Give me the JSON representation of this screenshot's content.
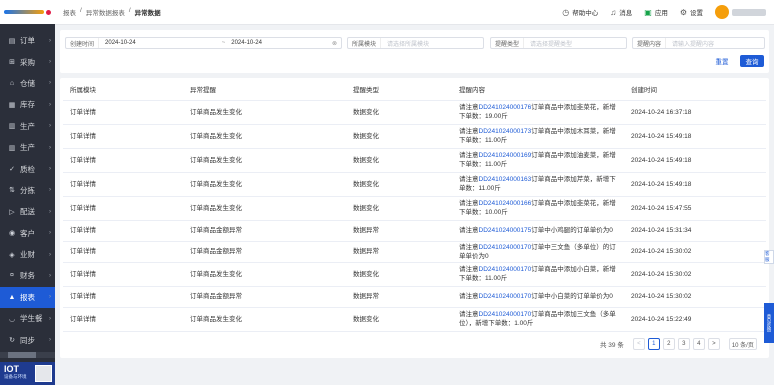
{
  "sidebar": {
    "items": [
      {
        "label": "订单",
        "icon": "document-icon"
      },
      {
        "label": "采购",
        "icon": "cart-icon"
      },
      {
        "label": "仓储",
        "icon": "warehouse-icon"
      },
      {
        "label": "库存",
        "icon": "box-icon"
      },
      {
        "label": "生产",
        "icon": "factory-icon"
      },
      {
        "label": "生产",
        "icon": "factory-icon"
      },
      {
        "label": "质检",
        "icon": "check-icon"
      },
      {
        "label": "分拣",
        "icon": "sort-icon"
      },
      {
        "label": "配送",
        "icon": "truck-icon"
      },
      {
        "label": "客户",
        "icon": "user-icon"
      },
      {
        "label": "业财",
        "icon": "finance-icon"
      },
      {
        "label": "财务",
        "icon": "money-icon"
      },
      {
        "label": "报表",
        "icon": "chart-icon"
      },
      {
        "label": "学生餐",
        "icon": "bowl-icon"
      },
      {
        "label": "同步",
        "icon": "sync-icon"
      }
    ],
    "active_index": 12,
    "iot": {
      "title": "IOT",
      "subtitle": "设备与环境"
    }
  },
  "header": {
    "breadcrumb": [
      "报表",
      "异常数据报表",
      "异常数据"
    ],
    "help": "帮助中心",
    "messages": "消息",
    "apps": "应用",
    "settings": "设置"
  },
  "filter": {
    "created_label": "创建时间",
    "date_start": "2024-10-24",
    "date_sep": "~",
    "date_end": "2024-10-24",
    "module_label": "所属模块",
    "module_placeholder": "请选择所属模块",
    "type_label": "提醒类型",
    "type_placeholder": "请选择提醒类型",
    "content_label": "提醒内容",
    "content_placeholder": "请输入提醒内容",
    "reset": "重置",
    "search": "查询"
  },
  "table": {
    "headers": [
      "所属模块",
      "异常提醒",
      "提醒类型",
      "提醒内容",
      "创建时间"
    ],
    "rows": [
      {
        "module": "订单详情",
        "alert": "订单商品发生变化",
        "type": "数据变化",
        "pre": "请注意",
        "code": "DD241024000176",
        "post": "订单商品中添加韭菜花，新增下单数：19.00斤",
        "time": "2024-10-24 16:37:18"
      },
      {
        "module": "订单详情",
        "alert": "订单商品发生变化",
        "type": "数据变化",
        "pre": "请注意",
        "code": "DD241024000173",
        "post": "订单商品中添加木耳菜，新增下单数：11.00斤",
        "time": "2024-10-24 15:49:18"
      },
      {
        "module": "订单详情",
        "alert": "订单商品发生变化",
        "type": "数据变化",
        "pre": "请注意",
        "code": "DD241024000169",
        "post": "订单商品中添加油麦菜，新增下单数：11.00斤",
        "time": "2024-10-24 15:49:18"
      },
      {
        "module": "订单详情",
        "alert": "订单商品发生变化",
        "type": "数据变化",
        "pre": "请注意",
        "code": "DD241024000163",
        "post": "订单商品中添加芹菜，新增下单数：11.00斤",
        "time": "2024-10-24 15:49:18"
      },
      {
        "module": "订单详情",
        "alert": "订单商品发生变化",
        "type": "数据变化",
        "pre": "请注意",
        "code": "DD241024000166",
        "post": "订单商品中添加韭菜花，新增下单数：10.00斤",
        "time": "2024-10-24 15:47:55"
      },
      {
        "module": "订单详情",
        "alert": "订单商品金额异常",
        "type": "数据异常",
        "pre": "请注意",
        "code": "DD241024000175",
        "post": "订单中小鸡腿的订单单价为0",
        "time": "2024-10-24 15:31:34"
      },
      {
        "module": "订单详情",
        "alert": "订单商品金额异常",
        "type": "数据异常",
        "pre": "请注意",
        "code": "DD241024000170",
        "post": "订单中三文鱼（多单位）的订单单价为0",
        "time": "2024-10-24 15:30:02"
      },
      {
        "module": "订单详情",
        "alert": "订单商品发生变化",
        "type": "数据变化",
        "pre": "请注意",
        "code": "DD241024000170",
        "post": "订单商品中添加小白菜，新增下单数：11.00斤",
        "time": "2024-10-24 15:30:02"
      },
      {
        "module": "订单详情",
        "alert": "订单商品金额异常",
        "type": "数据异常",
        "pre": "请注意",
        "code": "DD241024000170",
        "post": "订单中小白菜的订单单价为0",
        "time": "2024-10-24 15:30:02"
      },
      {
        "module": "订单详情",
        "alert": "订单商品发生变化",
        "type": "数据变化",
        "pre": "请注意",
        "code": "DD241024000170",
        "post": "订单商品中添加三文鱼（多单位），新增下单数：1.00斤",
        "time": "2024-10-24 15:22:49"
      }
    ]
  },
  "pagination": {
    "total": "共 39 条",
    "prev": "<",
    "pages": [
      "1",
      "2",
      "3",
      "4"
    ],
    "current": "1",
    "next": ">",
    "size": "10 条/页"
  },
  "floating": {
    "service": "客服",
    "feedback": "意见反馈"
  },
  "colors": {
    "primary": "#1e5bd6",
    "sidebar": "#2b2f3a"
  }
}
